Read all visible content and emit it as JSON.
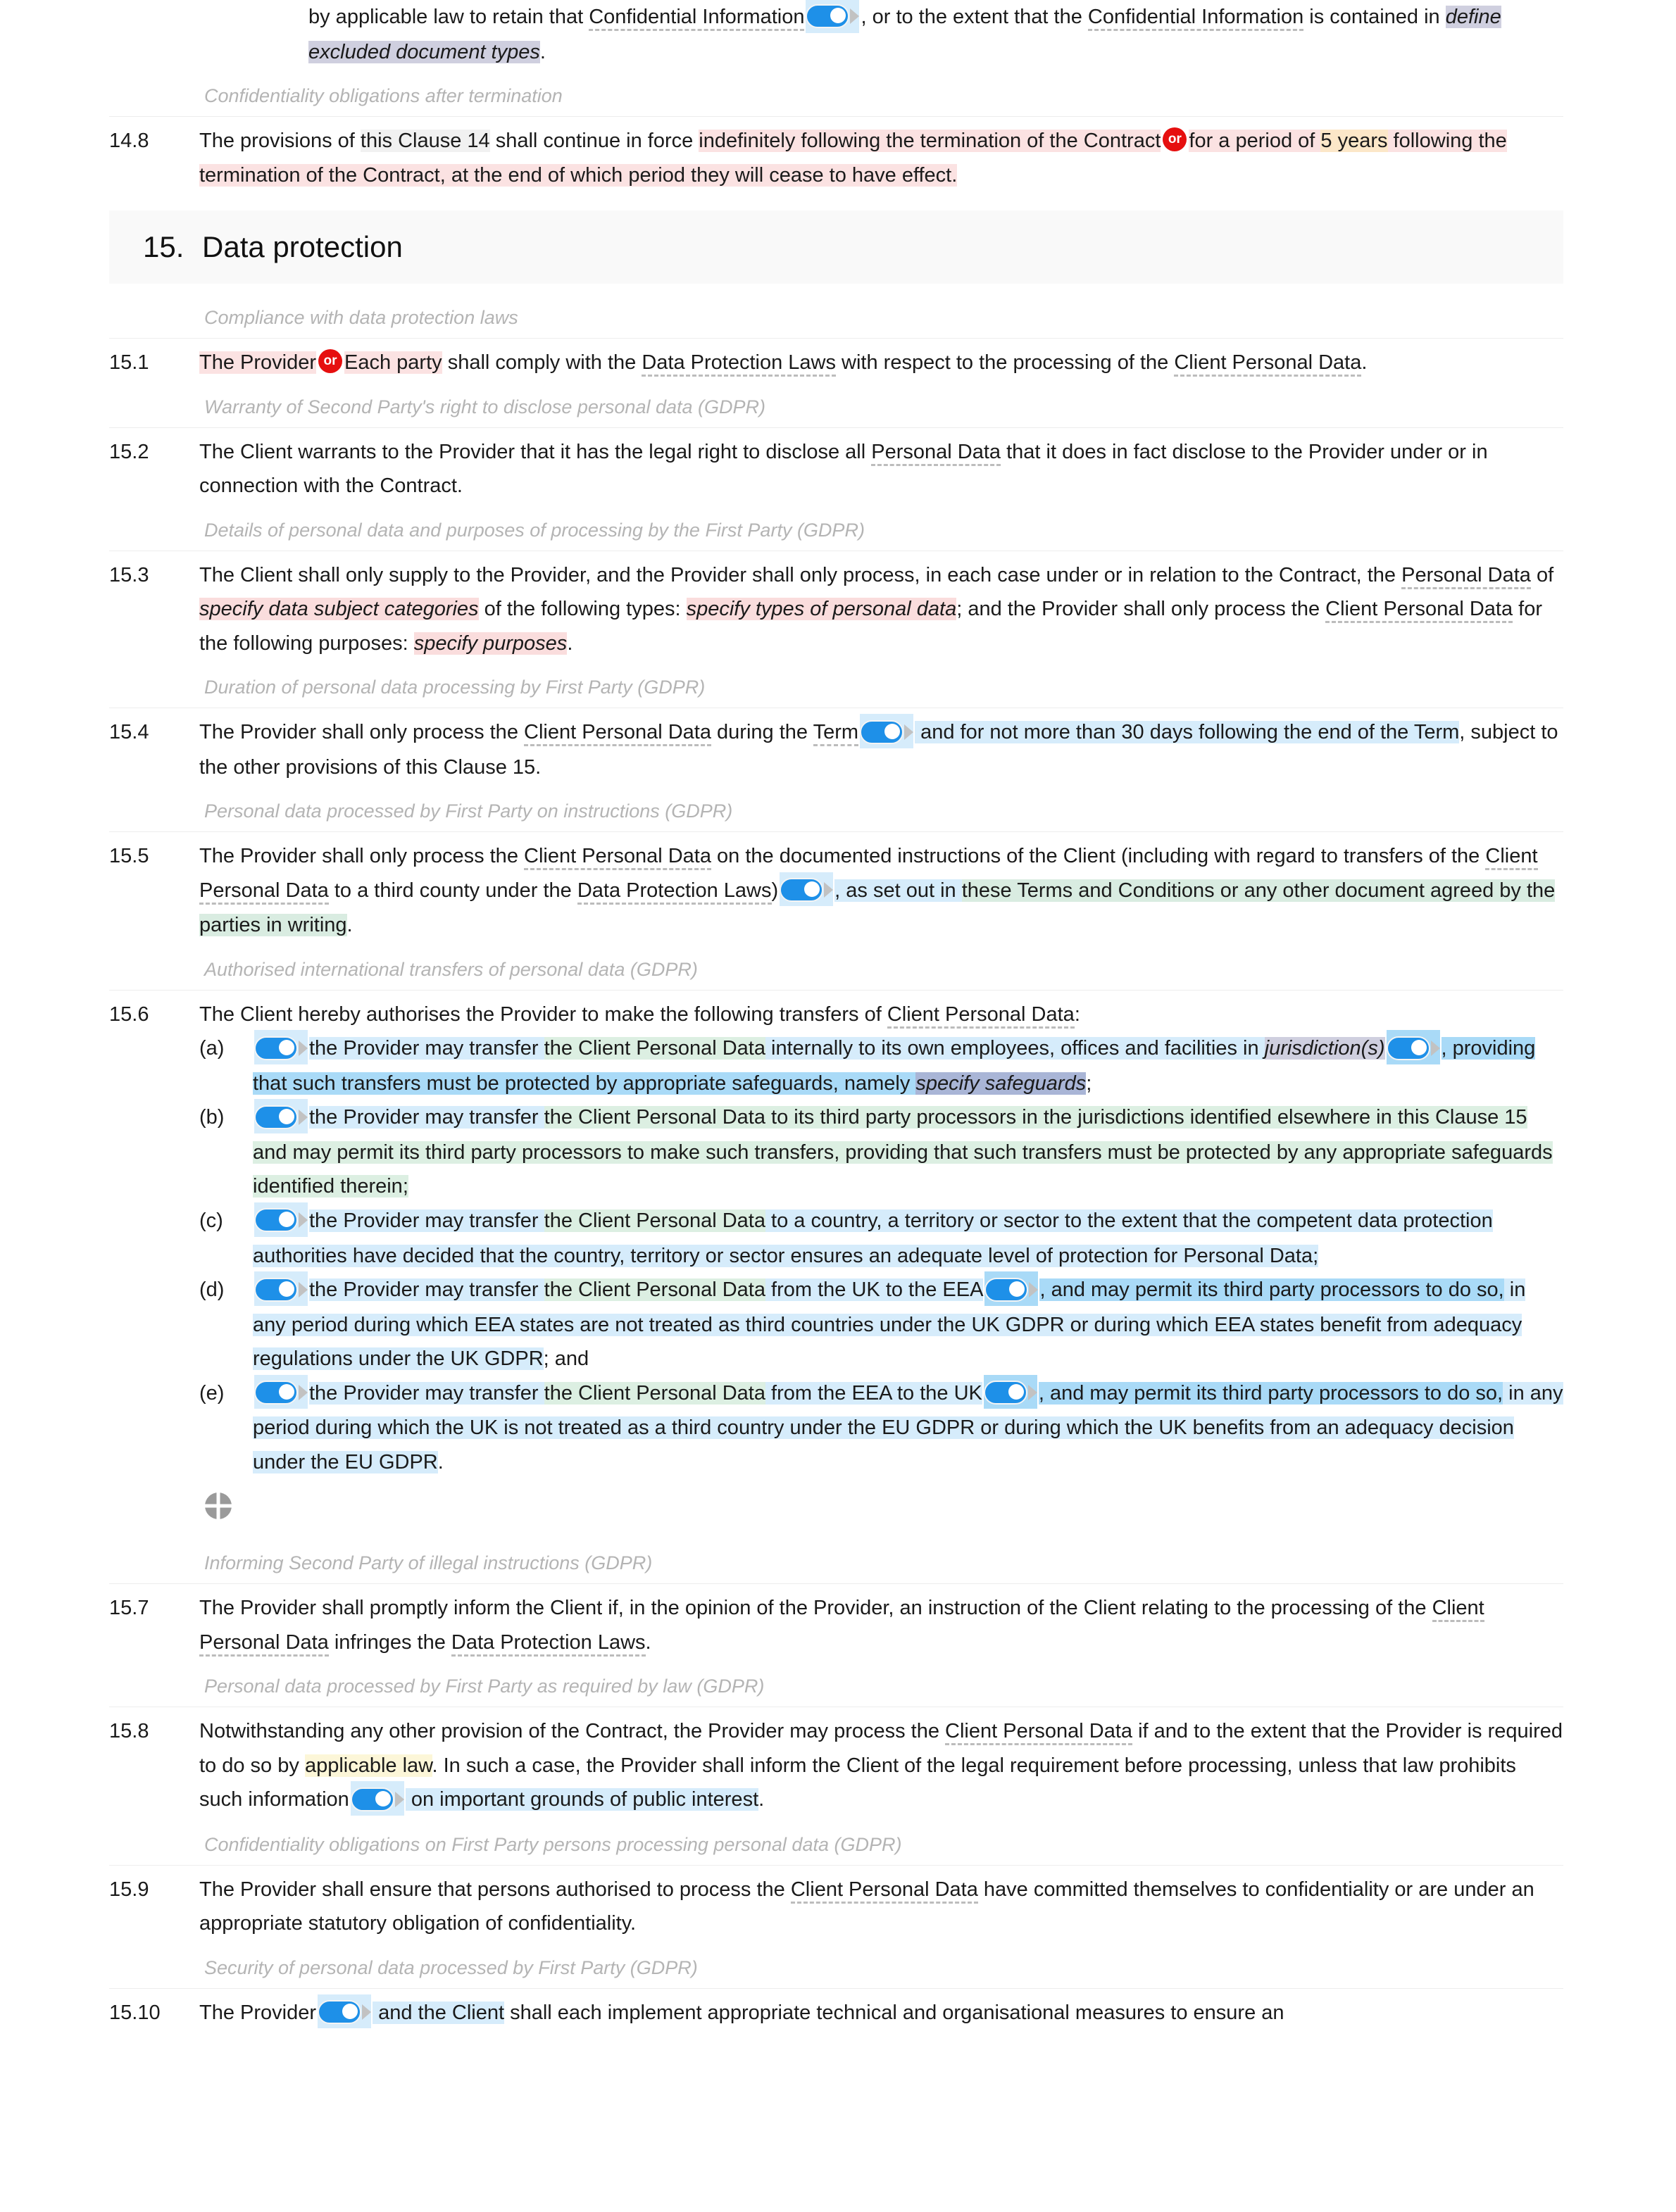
{
  "document": {
    "type": "legal-contract-editor",
    "accent_red": "#e60f0f",
    "accent_blue": "#1e90e8"
  },
  "top_clause": {
    "lead_1": "by applicable law to retain that ",
    "term_1": "Confidential Information",
    "lead_2": ", or to the extent that the ",
    "term_2": "Confidential Information",
    "lead_3": " is contained in ",
    "placeholder": "define excluded document types",
    "tail": "."
  },
  "guide_headings": {
    "g1": "Confidentiality obligations after termination",
    "g2": "Compliance with data protection laws",
    "g3": "Warranty of Second Party's right to disclose personal data (GDPR)",
    "g4": "Details of personal data and purposes of processing by the First Party (GDPR)",
    "g5": "Duration of personal data processing by First Party (GDPR)",
    "g6": "Personal data processed by First Party on instructions (GDPR)",
    "g7": "Authorised international transfers of personal data (GDPR)",
    "g8": "Informing Second Party of illegal instructions (GDPR)",
    "g9": "Personal data processed by First Party as required by law (GDPR)",
    "g10": "Confidentiality obligations on First Party persons processing personal data (GDPR)",
    "g11": "Security of personal data processed by First Party (GDPR)"
  },
  "section": {
    "number": "15.",
    "title": "Data protection"
  },
  "or_label": "or",
  "clauses": {
    "c14_8": {
      "num": "14.8",
      "p1": "The provisions of ",
      "hl_grey": "this Clause 14",
      "p2": " shall continue in force ",
      "pink1": "indefinitely following the termination of the Contract",
      "pink2": "for a period of ",
      "cream": "5 years",
      "pink3": " following the termination of the Contract, at the end of which period they will cease to have effect."
    },
    "c15_1": {
      "num": "15.1",
      "pink1": "The Provider",
      "pink2": "Each party",
      "p1": " shall comply with the ",
      "term1": "Data Protection Laws",
      "p2": " with respect to the processing of the ",
      "term2": "Client Personal Data",
      "p3": "."
    },
    "c15_2": {
      "num": "15.2",
      "p1": "The Client warrants to the Provider that it has the legal right to disclose all ",
      "term1": "Personal Data",
      "p2": " that it does in fact disclose to the Provider under or in connection with the Contract."
    },
    "c15_3": {
      "num": "15.3",
      "p1": "The Client shall only supply to the Provider, and the Provider shall only process, in each case under or in relation to the Contract, the ",
      "term1": "Personal Data",
      "p2": " of ",
      "ph1": "specify data subject categories",
      "p3": " of the following types: ",
      "ph2": "specify types of personal data",
      "p4": "; and the Provider shall only process the ",
      "term2": "Client Personal Data",
      "p5": " for the following purposes: ",
      "ph3": "specify purposes",
      "p6": "."
    },
    "c15_4": {
      "num": "15.4",
      "p1": "The Provider shall only process the ",
      "term1": "Client Personal Data",
      "p2": " during the ",
      "term2": "Term",
      "blue1": " and for not more than 30 days following the end of the Term",
      "p3": ", subject to the other provisions of this Clause 15."
    },
    "c15_5": {
      "num": "15.5",
      "p1": "The Provider shall only process the ",
      "term1": "Client Personal Data",
      "p2": " on the documented instructions of the Client (including with regard to transfers of the ",
      "term2": "Client Personal Data",
      "p3": " to a third county under the ",
      "term3": "Data Protection Laws",
      "p4": ")",
      "blue1": ", as set out in ",
      "green1": "these Terms and Conditions or any other document agreed by the parties in writing",
      "p5": "."
    },
    "c15_6": {
      "num": "15.6",
      "intro_p1": "The Client hereby authorises the Provider to make the following transfers of ",
      "intro_term": "Client Personal Data",
      "intro_p2": ":",
      "items": [
        {
          "marker": "(a)",
          "blue1": "the Provider may transfer ",
          "green1": "the Client Personal Data",
          "blue2": " internally to its own employees, offices and facilities in ",
          "lav1": "jurisdiction(s)",
          "blue3": ", providing that such transfers must be protected by appropriate safeguards, namely ",
          "lav2": "specify safeguards",
          "tail": ";"
        },
        {
          "marker": "(b)",
          "blue1": "the Provider may transfer ",
          "green1": "the Client Personal Data",
          "green2": " to its third party processors in the jurisdictions identified elsewhere in this Clause 15",
          "green3": " and may permit its third party processors to make such transfers, providing that such transfers must be protected by any appropriate safeguards identified therein;"
        },
        {
          "marker": "(c)",
          "blue1": "the Provider may transfer ",
          "green1": "the Client Personal Data",
          "blue2": " to a country, a territory or sector to the extent that the competent data protection authorities have decided that the country, territory or sector ensures an adequate level of protection for Personal Data;"
        },
        {
          "marker": "(d)",
          "blue1": "the Provider may transfer ",
          "green1": "the Client Personal Data",
          "blue2": " from the UK to the EEA",
          "blue3": ", and may permit its third party ",
          "blues1": "processors to do so,",
          "blue4": " in any period during which EEA states are not treated as third countries under the UK GDPR or during which EEA states benefit from adequacy regulations under the UK GDPR",
          "tail": "; and"
        },
        {
          "marker": "(e)",
          "blue1": "the Provider may transfer ",
          "green1": "the Client Personal Data",
          "blue2": " from the EEA to the UK",
          "blue3": ", and may permit its third party ",
          "blues1": "processors to do so,",
          "blue4": " in any period during which the UK is not treated as a third country under the EU GDPR or during which the UK benefits from an adequacy decision under the EU GDPR",
          "tail": "."
        }
      ]
    },
    "c15_7": {
      "num": "15.7",
      "p1": "The Provider shall promptly inform the Client if, in the opinion of the Provider, an instruction of the Client relating to the processing of the ",
      "term1": "Client Personal Data",
      "p2": " infringes the ",
      "term2": "Data Protection Laws",
      "p3": "."
    },
    "c15_8": {
      "num": "15.8",
      "p1": "Notwithstanding any other provision of the Contract, the Provider may process the ",
      "term1": "Client Personal Data",
      "p2": " if and to the extent that the Provider is required to do so by ",
      "yellow1": "applicable law",
      "p3": ". In such a case, the Provider shall inform the Client of the legal requirement before processing, unless that law prohibits such information",
      "blue1": " on important grounds of public interest",
      "p4": "."
    },
    "c15_9": {
      "num": "15.9",
      "p1": "The Provider shall ensure that persons authorised to process the ",
      "term1": "Client Personal Data",
      "p2": " have committed themselves to confidentiality or are under an appropriate statutory obligation of confidentiality."
    },
    "c15_10": {
      "num": "15.10",
      "p1": "The Provider",
      "blue1": " and the Client",
      "p2": " shall each implement appropriate technical and organisational measures to ensure an"
    }
  },
  "icons": {
    "crosshair": "crosshair-icon",
    "toggle": "toggle-switch",
    "caret": "caret-right-icon"
  }
}
